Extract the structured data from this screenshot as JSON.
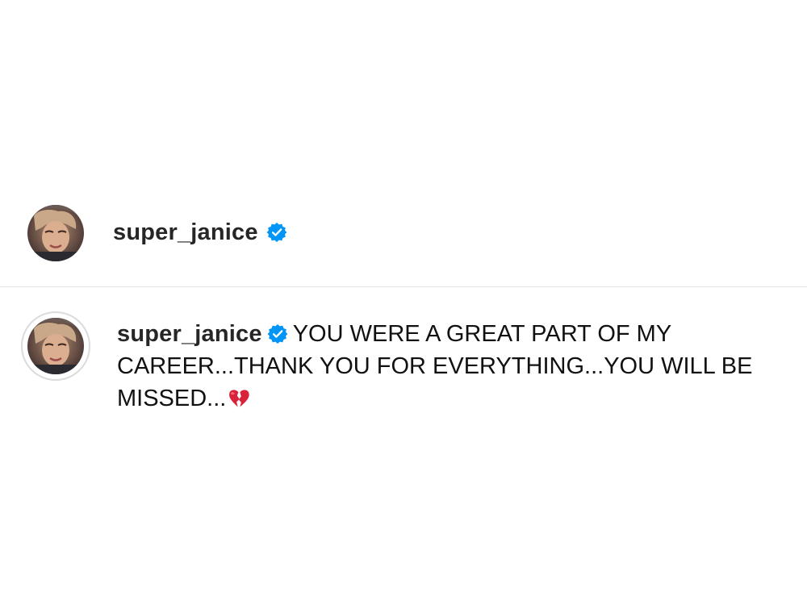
{
  "header": {
    "username": "super_janice",
    "verified": true,
    "avatar_icon": "profile-photo"
  },
  "caption": {
    "username": "super_janice",
    "verified": true,
    "avatar_icon": "profile-photo",
    "text": "YOU WERE A GREAT PART OF MY CAREER...THANK YOU FOR EVERYTHING...YOU WILL BE MISSED...",
    "emoji_icon": "broken-heart-icon"
  },
  "colors": {
    "verified_badge": "#0095f6",
    "text": "#111111",
    "divider": "#e6e6e6",
    "broken_heart": "#d9233a"
  }
}
